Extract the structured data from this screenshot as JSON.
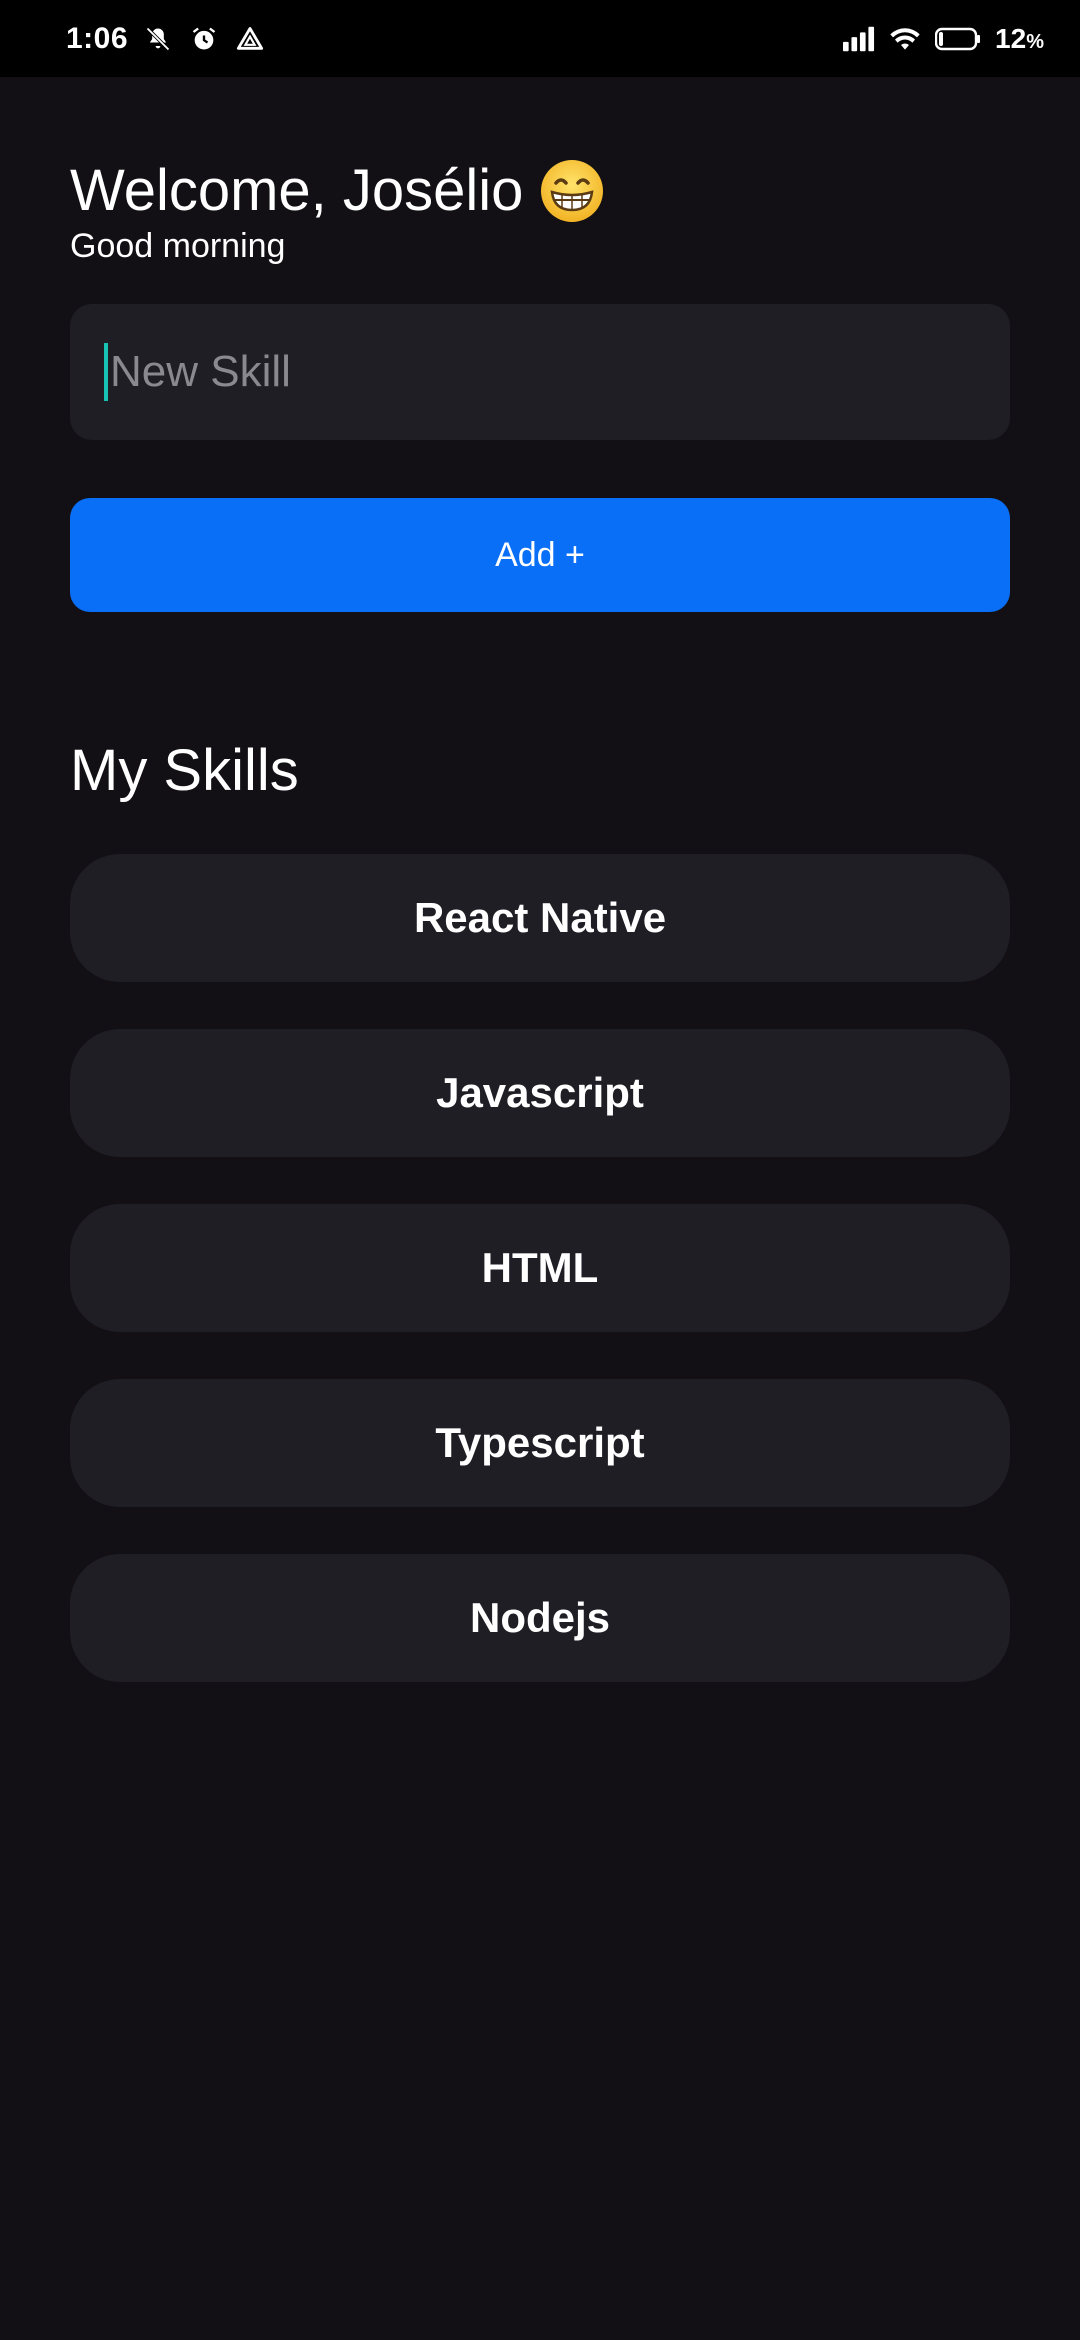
{
  "status_bar": {
    "time": "1:06",
    "icons_left": [
      "mute-icon",
      "alarm-icon",
      "drive-icon"
    ],
    "icons_right": [
      "signal-icon",
      "wifi-icon",
      "battery-icon"
    ],
    "battery_value": "12",
    "battery_unit": "%"
  },
  "header": {
    "title": "Welcome, Josélio",
    "emoji": "grinning-face-icon",
    "subtitle": "Good morning"
  },
  "input": {
    "placeholder": "New Skill",
    "value": ""
  },
  "add_button": {
    "label": "Add +"
  },
  "skills_section": {
    "title": "My Skills",
    "items": [
      {
        "name": "React Native"
      },
      {
        "name": "Javascript"
      },
      {
        "name": "HTML"
      },
      {
        "name": "Typescript"
      },
      {
        "name": "Nodejs"
      }
    ]
  },
  "colors": {
    "background": "#121015",
    "card": "#1f1e25",
    "accent": "#0a6ff7",
    "caret": "#17c4b3"
  }
}
